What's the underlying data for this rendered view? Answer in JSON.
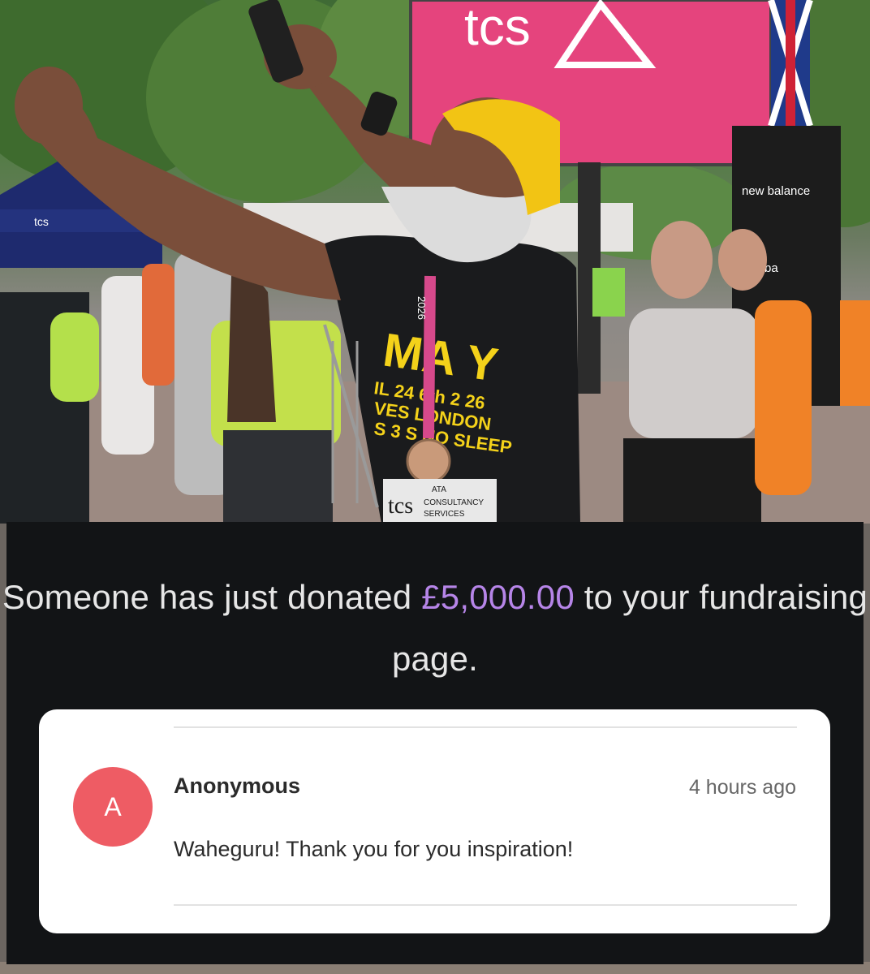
{
  "photo": {
    "sponsor_logo": "tcs",
    "sponsor_small": "tcs",
    "new_balance_1": "new balance",
    "new_balance_2": "ba",
    "shirt_lines": [
      "MA Y",
      "IL 24  6th 2 26",
      "VES   LONDON",
      "S 3  S NO SLEEP"
    ],
    "shirt_brand": "tcs",
    "shirt_sub_1": "ATA",
    "shirt_sub_2": "CONSULTANCY",
    "shirt_sub_3": "SERVICES",
    "medal_text": "2026",
    "colors": {
      "billboard": "#e5447d",
      "turban": "#f2c414",
      "shirt_print": "#f4d21a",
      "grass": "#4e7d3f"
    }
  },
  "notification": {
    "prefix": "Someone has just donated",
    "amount": "£5,000.00",
    "suffix": "to your fundraising page.",
    "accent_color": "#b685e8"
  },
  "donation": {
    "avatar_letter": "A",
    "avatar_color": "#ee5c64",
    "donor_name": "Anonymous",
    "time_ago": "4 hours ago",
    "message": "Waheguru! Thank you for you inspiration!"
  }
}
